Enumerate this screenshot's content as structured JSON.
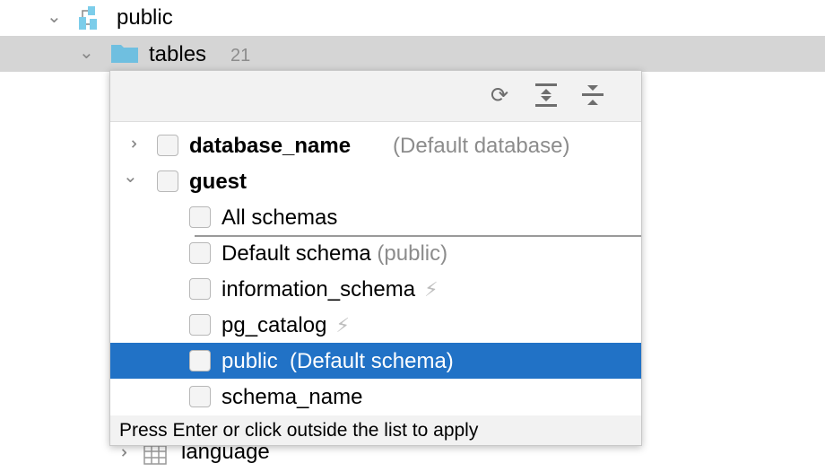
{
  "tree": {
    "public_label": "public",
    "tables_label": "tables",
    "tables_count": "21",
    "language_label": "language"
  },
  "popup": {
    "toolbar": {
      "refresh": "refresh-icon",
      "expand_all": "expand-all-icon",
      "collapse_all": "collapse-all-icon"
    },
    "databases": [
      {
        "name": "database_name",
        "note": "(Default database)",
        "expanded": false
      },
      {
        "name": "guest",
        "note": "",
        "expanded": true
      }
    ],
    "schemas": [
      {
        "name": "All schemas",
        "note": ""
      },
      {
        "name": "Default schema",
        "note": " (public)"
      },
      {
        "name": "information_schema",
        "note": "",
        "bolt": true
      },
      {
        "name": "pg_catalog",
        "note": "",
        "bolt": true
      },
      {
        "name": "public",
        "note": "  (Default schema)",
        "selected": true
      },
      {
        "name": "schema_name",
        "note": ""
      }
    ],
    "footer": "Press Enter or click outside the list to apply",
    "selection_color": "#2172c6"
  }
}
